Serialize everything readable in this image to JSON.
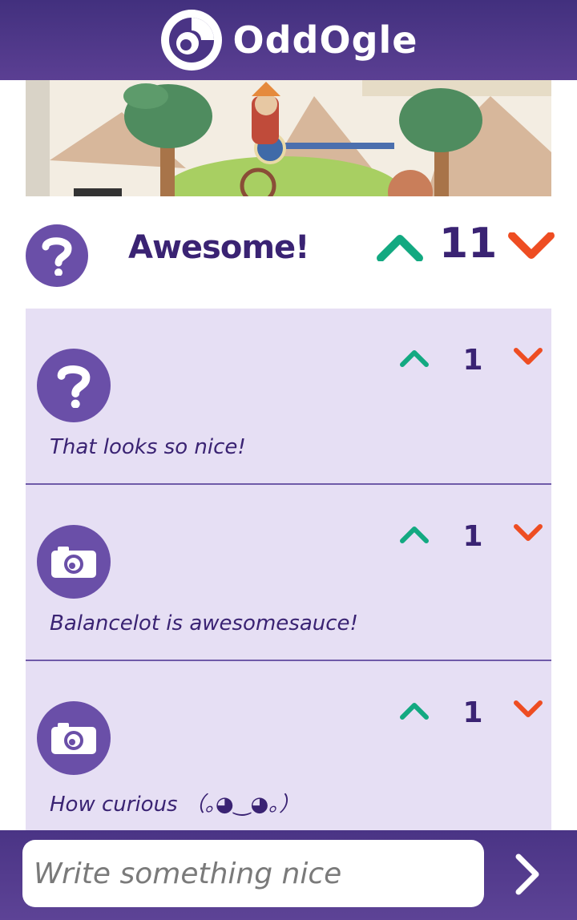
{
  "app": {
    "name": "OddOgle"
  },
  "post": {
    "title": "Awesome!",
    "votes": "11",
    "colors": {
      "upvote": "#13a981",
      "downvote": "#ee4d22",
      "accent": "#3a2373"
    }
  },
  "comments": [
    {
      "avatar_icon": "question-icon",
      "text": "That looks so nice!",
      "votes": "1"
    },
    {
      "avatar_icon": "camera-icon",
      "text": "Balancelot is awesomesauce!",
      "votes": "1"
    },
    {
      "avatar_icon": "camera-icon",
      "text": "How curious （｡◕‿◕｡）",
      "votes": "1"
    }
  ],
  "compose": {
    "placeholder": "Write something nice",
    "value": ""
  }
}
